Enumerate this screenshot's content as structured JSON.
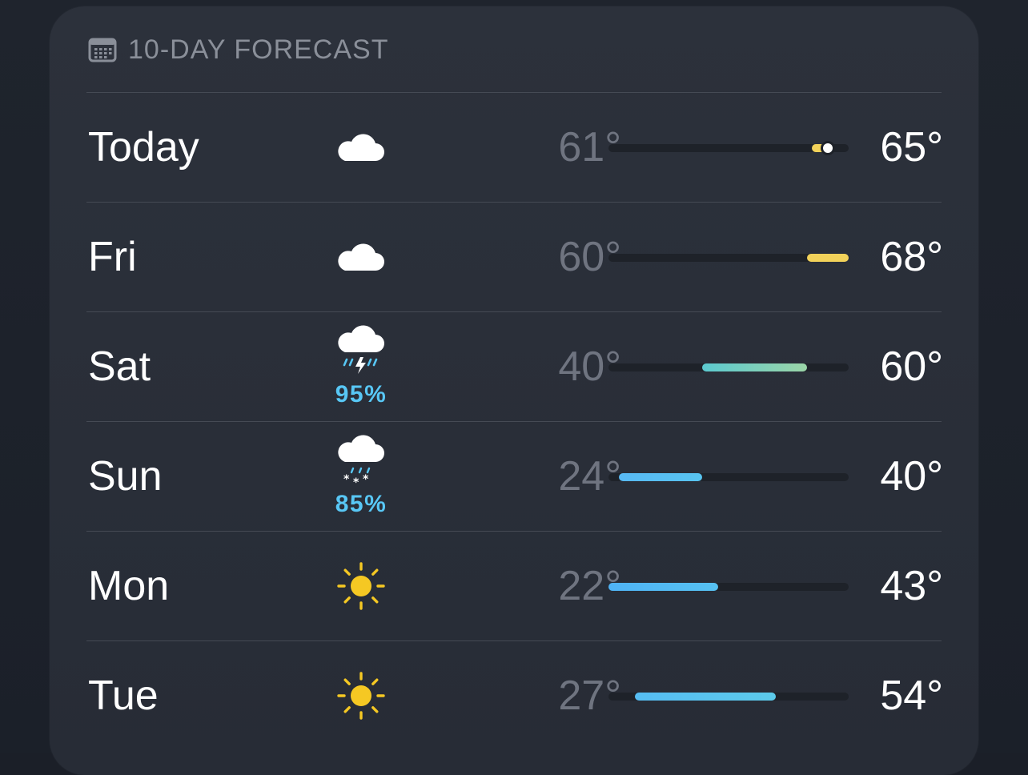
{
  "header": {
    "title": "10-DAY FORECAST",
    "icon": "calendar-icon"
  },
  "scale": {
    "min": 22,
    "max": 68
  },
  "days": [
    {
      "day": "Today",
      "icon": "cloud-icon",
      "precip": "",
      "low": "61°",
      "high": "65°",
      "low_value": 61,
      "high_value": 65,
      "current_value": 64,
      "bar_colors": [
        "#f2d25a",
        "#f2d25a"
      ]
    },
    {
      "day": "Fri",
      "icon": "cloud-icon",
      "precip": "",
      "low": "60°",
      "high": "68°",
      "low_value": 60,
      "high_value": 68,
      "bar_colors": [
        "#f2d25a",
        "#f2d25a"
      ]
    },
    {
      "day": "Sat",
      "icon": "thunderstorm-icon",
      "precip": "95%",
      "low": "40°",
      "high": "60°",
      "low_value": 40,
      "high_value": 60,
      "bar_colors": [
        "#5ccad0",
        "#9bd5a7"
      ]
    },
    {
      "day": "Sun",
      "icon": "snow-icon",
      "precip": "85%",
      "low": "24°",
      "high": "40°",
      "low_value": 24,
      "high_value": 40,
      "bar_colors": [
        "#58b9f3",
        "#58c4f0"
      ]
    },
    {
      "day": "Mon",
      "icon": "sun-icon",
      "precip": "",
      "low": "22°",
      "high": "43°",
      "low_value": 22,
      "high_value": 43,
      "bar_colors": [
        "#4fb3f5",
        "#56c1f1"
      ]
    },
    {
      "day": "Tue",
      "icon": "sun-icon",
      "precip": "",
      "low": "27°",
      "high": "54°",
      "low_value": 27,
      "high_value": 54,
      "bar_colors": [
        "#56bdf3",
        "#5ccaea"
      ]
    }
  ]
}
